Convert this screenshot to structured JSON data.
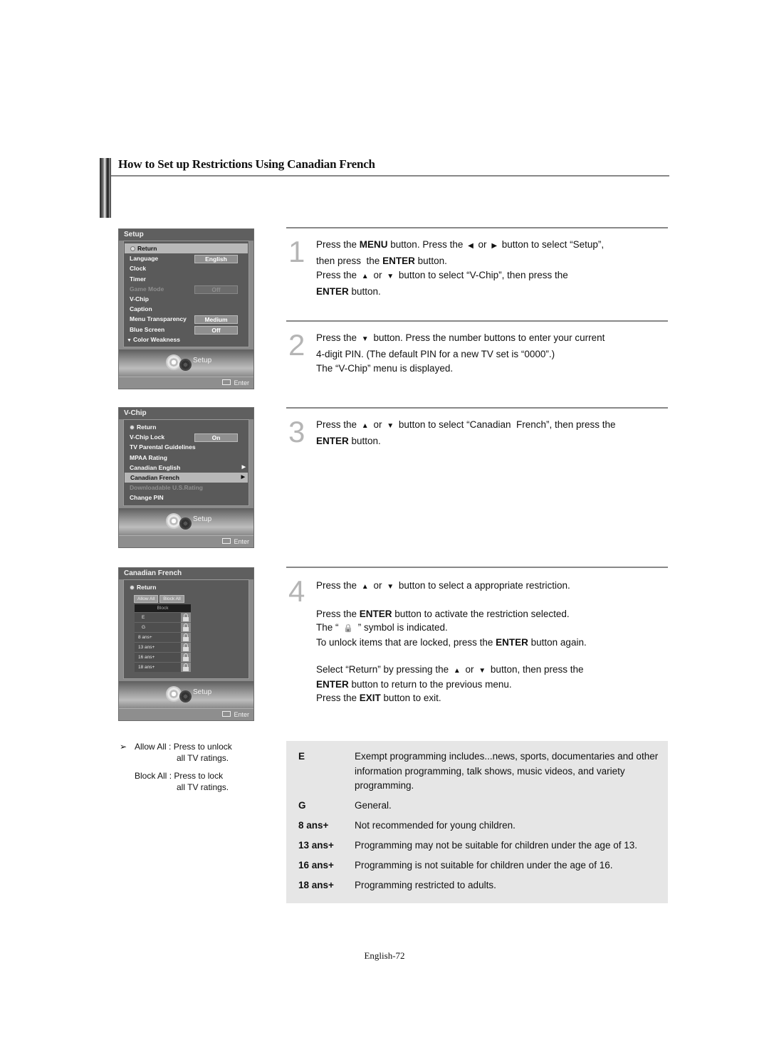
{
  "section": {
    "title": "How to Set up Restrictions Using Canadian French"
  },
  "osd_setup": {
    "title": "Setup",
    "items": [
      {
        "label": "Return",
        "value": null,
        "state": "selected",
        "icon": "return-icon"
      },
      {
        "label": "Language",
        "value": "English",
        "state": "normal"
      },
      {
        "label": "Clock",
        "value": null,
        "state": "normal"
      },
      {
        "label": "Timer",
        "value": null,
        "state": "normal"
      },
      {
        "label": "Game Mode",
        "value": "Off",
        "state": "disabled"
      },
      {
        "label": "V-Chip",
        "value": null,
        "state": "normal"
      },
      {
        "label": "Caption",
        "value": null,
        "state": "normal"
      },
      {
        "label": "Menu Transparency",
        "value": "Medium",
        "state": "normal"
      },
      {
        "label": "Blue Screen",
        "value": "Off",
        "state": "normal"
      },
      {
        "label": "Color Weakness",
        "value": null,
        "state": "normal",
        "more_indicator": "▼"
      }
    ],
    "footer_label": "Setup",
    "enter_label": "Enter"
  },
  "osd_vchip": {
    "title": "V-Chip",
    "items": [
      {
        "label": "Return",
        "icon": "return-icon",
        "state": "normal"
      },
      {
        "label": "V-Chip Lock",
        "value": "On",
        "state": "normal"
      },
      {
        "label": "TV Parental Guidelines",
        "state": "normal"
      },
      {
        "label": "MPAA Rating",
        "state": "normal"
      },
      {
        "label": "Canadian English",
        "state": "normal",
        "submenu": "▶"
      },
      {
        "label": "Canadian French",
        "state": "selected",
        "submenu": "▶"
      },
      {
        "label": "Downloadable U.S.Rating",
        "state": "disabled"
      },
      {
        "label": "Change PIN",
        "state": "normal"
      }
    ],
    "footer_label": "Setup",
    "enter_label": "Enter"
  },
  "osd_cf": {
    "title": "Canadian French",
    "return_label": "Return",
    "allow_all": "Allow All",
    "block_all": "Block All",
    "grid_header": "Block",
    "ratings": [
      "E",
      "G",
      "8 ans+",
      "13 ans+",
      "16 ans+",
      "18 ans+"
    ],
    "footer_label": "Setup",
    "enter_label": "Enter"
  },
  "steps": [
    {
      "number": "1",
      "lines": [
        [
          {
            "t": "Press the "
          },
          {
            "t": "MENU",
            "b": true
          },
          {
            "t": " button. Press the "
          },
          {
            "g": "◀"
          },
          {
            "t": " or "
          },
          {
            "g": "▶"
          },
          {
            "t": " button to select “Setup”,"
          }
        ],
        [
          {
            "t": "then press  the "
          },
          {
            "t": "ENTER",
            "b": true
          },
          {
            "t": " button."
          }
        ],
        [
          {
            "t": "Press the "
          },
          {
            "g": "▲"
          },
          {
            "t": " or "
          },
          {
            "g": "▼"
          },
          {
            "t": " button to select “V-Chip”, then press the"
          }
        ],
        [
          {
            "t": "ENTER",
            "b": true
          },
          {
            "t": " button."
          }
        ]
      ]
    },
    {
      "number": "2",
      "lines": [
        [
          {
            "t": "Press the "
          },
          {
            "g": "▼"
          },
          {
            "t": " button. Press the number buttons to enter your current"
          }
        ],
        [
          {
            "t": "4-digit PIN. (The default PIN for a new TV set is “0000”.)"
          }
        ],
        [
          {
            "t": "The “V-Chip” menu is displayed."
          }
        ]
      ]
    },
    {
      "number": "3",
      "lines": [
        [
          {
            "t": "Press the "
          },
          {
            "g": "▲"
          },
          {
            "t": " or "
          },
          {
            "g": "▼"
          },
          {
            "t": " button to select “Canadian  French”, then press the"
          }
        ],
        [
          {
            "t": "ENTER",
            "b": true
          },
          {
            "t": " button."
          }
        ]
      ]
    },
    {
      "number": "4",
      "lines": [
        [
          {
            "t": "Press the "
          },
          {
            "g": "▲"
          },
          {
            "t": " or "
          },
          {
            "g": "▼"
          },
          {
            "t": " button to select a appropriate restriction."
          }
        ],
        [],
        [
          {
            "t": "Press the "
          },
          {
            "t": "ENTER",
            "b": true
          },
          {
            "t": " button to activate the restriction selected."
          }
        ],
        [
          {
            "t": "The “ "
          },
          {
            "g": "🔒"
          },
          {
            "t": " ” symbol is indicated."
          }
        ],
        [
          {
            "t": "To unlock items that are locked, press the "
          },
          {
            "t": "ENTER",
            "b": true
          },
          {
            "t": " button again."
          }
        ],
        [],
        [
          {
            "t": "Select “Return” by pressing the "
          },
          {
            "g": "▲"
          },
          {
            "t": " or "
          },
          {
            "g": "▼"
          },
          {
            "t": " button, then press the"
          }
        ],
        [
          {
            "t": "ENTER",
            "b": true
          },
          {
            "t": " button to return to the previous menu."
          }
        ],
        [
          {
            "t": "Press the "
          },
          {
            "t": "EXIT",
            "b": true
          },
          {
            "t": " button to exit."
          }
        ]
      ]
    }
  ],
  "note": {
    "arrow_icon": "➢",
    "items": [
      {
        "term": "Allow All",
        "desc1": "Press to unlock",
        "desc2": "all TV ratings."
      },
      {
        "term": "Block All",
        "desc1": "Press to lock",
        "desc2": "all TV ratings."
      }
    ]
  },
  "rating_table": [
    {
      "code": "E",
      "desc": "Exempt programming includes...news, sports, documentaries and other information programming, talk shows, music videos, and variety programming."
    },
    {
      "code": "G",
      "desc": "General."
    },
    {
      "code": "8 ans+",
      "desc": "Not recommended for young children."
    },
    {
      "code": "13 ans+",
      "desc": "Programming may not be suitable for children under the age of 13."
    },
    {
      "code": "16 ans+",
      "desc": "Programming is not suitable for children under the age of 16."
    },
    {
      "code": "18 ans+",
      "desc": "Programming restricted to adults."
    }
  ],
  "page_number": "English-72"
}
